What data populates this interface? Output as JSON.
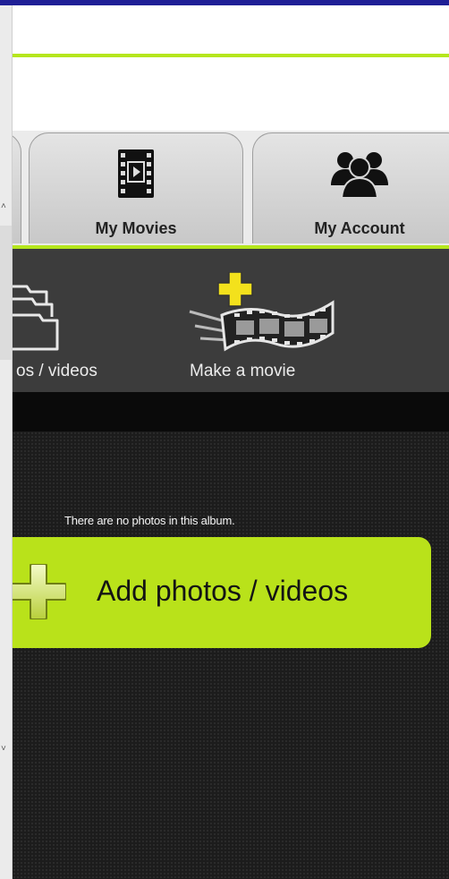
{
  "tabs": {
    "movies_label": "My Movies",
    "account_label": "My Account"
  },
  "toolbar": {
    "add_label": "os / videos",
    "movie_label": "Make a movie"
  },
  "content": {
    "empty_message": "There are no photos in this album.",
    "add_button_label": "Add photos / videos"
  },
  "icons": {
    "movies": "film-icon",
    "account": "group-icon",
    "albums": "folders-icon",
    "make_movie": "film-strip-plus-icon",
    "add": "plus-icon"
  },
  "colors": {
    "accent": "#b5e61d",
    "button": "#b9e21a",
    "toolbar": "#3c3c3c",
    "content_bg": "#1c1c1c",
    "frame": "#1f1f96"
  }
}
